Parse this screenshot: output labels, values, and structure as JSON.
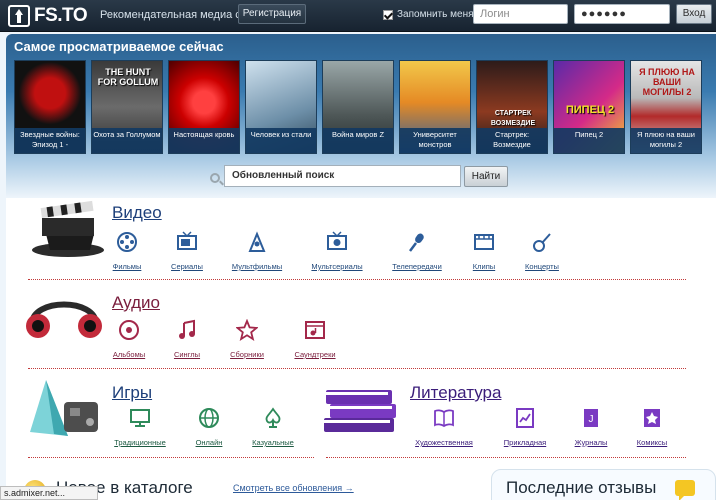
{
  "header": {
    "logo": "FS.TO",
    "slogan": "Рекомендательная медиа сеть",
    "register_label": "Регистрация",
    "remember_label": "Запомнить меня",
    "login_placeholder": "Логин",
    "password_value": "●●●●●●",
    "enter_label": "Вход"
  },
  "popular": {
    "title": "Самое просматриваемое сейчас",
    "movies": [
      {
        "caption": "Звездные войны: Эпизод 1 -",
        "poster_text": ""
      },
      {
        "caption": "Охота за Голлумом",
        "poster_text": "THE HUNT FOR GOLLUM"
      },
      {
        "caption": "Настоящая кровь",
        "poster_text": ""
      },
      {
        "caption": "Человек из стали",
        "poster_text": ""
      },
      {
        "caption": "Война миров Z",
        "poster_text": ""
      },
      {
        "caption": "Университет монстров",
        "poster_text": ""
      },
      {
        "caption": "Стартрек: Возмездие",
        "poster_text": "СТАРТРЕК ВОЗМЕЗДИЕ"
      },
      {
        "caption": "Пипец 2",
        "poster_text": "ПИПЕЦ 2"
      },
      {
        "caption": "Я плюю на ваши могилы 2",
        "poster_text": "Я ПЛЮЮ НА ВАШИ МОГИЛЫ 2"
      }
    ]
  },
  "search": {
    "value": "Обновленный поиск",
    "button_label": "Найти"
  },
  "video": {
    "title": "Видео",
    "items": [
      "Фильмы",
      "Сериалы",
      "Мультфильмы",
      "Мультсериалы",
      "Телепередачи",
      "Клипы",
      "Концерты"
    ]
  },
  "audio": {
    "title": "Аудио",
    "items": [
      "Альбомы",
      "Синглы",
      "Сборники",
      "Саундтреки"
    ]
  },
  "games": {
    "title": "Игры",
    "items": [
      "Традиционные",
      "Онлайн",
      "Казуальные"
    ]
  },
  "literature": {
    "title": "Литература",
    "items": [
      "Художественная",
      "Прикладная",
      "Журналы",
      "Комиксы"
    ]
  },
  "catalog": {
    "new_title": "Новое в каталоге",
    "all_updates": "Смотреть все обновления →"
  },
  "reviews": {
    "title": "Последние отзывы"
  },
  "status_bar": "s.admixer.net...",
  "colors": {
    "accent": "#3a7bb0",
    "video": "#1d3f7a",
    "audio": "#7a1d3c",
    "literature": "#3b1d7a"
  }
}
